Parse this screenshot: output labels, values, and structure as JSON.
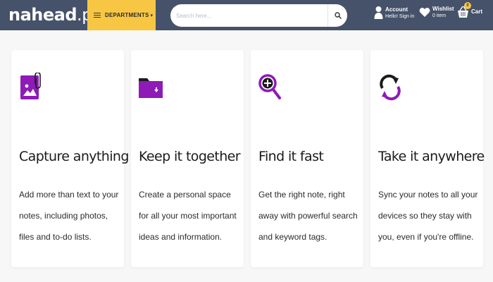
{
  "header": {
    "logo": {
      "bold": "nahe",
      "mid": "ad",
      "lite": ".pk"
    },
    "departments_label": "DEPARTMENTS",
    "search": {
      "placeholder": "Search here..."
    },
    "account": {
      "title": "Account",
      "subtitle": "Hello! Sign in"
    },
    "wishlist": {
      "title": "Wishlist",
      "subtitle": "0 item"
    },
    "cart": {
      "title": "Cart",
      "count": "0"
    },
    "colors": {
      "bar": "#45526a",
      "accent": "#f7c744"
    }
  },
  "features": [
    {
      "icon": "image-attachment-icon",
      "title": "Capture anything",
      "text": "Add more than text to your notes, including photos, files and to-do lists."
    },
    {
      "icon": "folder-icon",
      "title": "Keep it together",
      "text": "Create a personal space for all your most important ideas and information."
    },
    {
      "icon": "magnifier-icon",
      "title": "Find it fast",
      "text": "Get the right note, right away with powerful search and keyword tags."
    },
    {
      "icon": "sync-icon",
      "title": "Take it anywhere",
      "text": "Sync your notes to all your devices so they stay with you, even if you're offline."
    }
  ],
  "icon_color": "#8e1ab8"
}
